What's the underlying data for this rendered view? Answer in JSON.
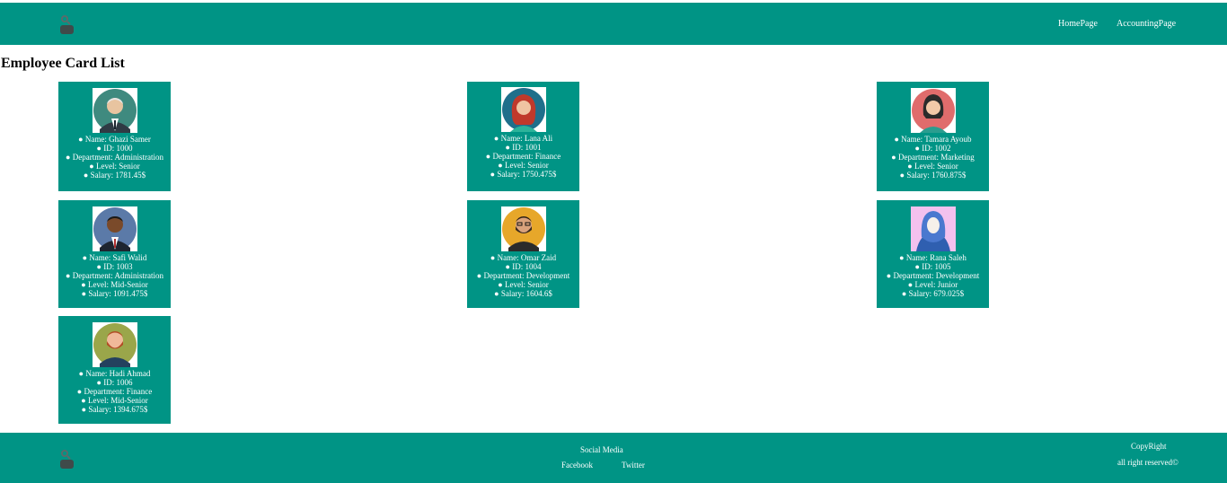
{
  "header": {
    "logo_icon": "user-search-icon",
    "nav": [
      {
        "label": "HomePage"
      },
      {
        "label": "AccountingPage"
      }
    ]
  },
  "main": {
    "title": "Employee Card List",
    "employees": [
      {
        "name": "● Name: Ghazi Samer",
        "id": "● ID: 1000",
        "department": "● Department: Administration",
        "level": "● Level: Senior",
        "salary": "● Salary: 1781.45$",
        "avatar_icon": "old-man-suit-avatar-icon"
      },
      {
        "name": "● Name: Lana Ali",
        "id": "● ID: 1001",
        "department": "● Department: Finance",
        "level": "● Level: Senior",
        "salary": "● Salary: 1750.475$",
        "avatar_icon": "red-hair-woman-avatar-icon"
      },
      {
        "name": "● Name: Tamara Ayoub",
        "id": "● ID: 1002",
        "department": "● Department: Marketing",
        "level": "● Level: Senior",
        "salary": "● Salary: 1760.875$",
        "avatar_icon": "dark-hair-woman-avatar-icon"
      },
      {
        "name": "● Name: Safi Walid",
        "id": "● ID: 1003",
        "department": "● Department: Administration",
        "level": "● Level: Mid-Senior",
        "salary": "● Salary: 1091.475$",
        "avatar_icon": "man-suit-avatar-icon"
      },
      {
        "name": "● Name: Omar Zaid",
        "id": "● ID: 1004",
        "department": "● Department: Development",
        "level": "● Level: Senior",
        "salary": "● Salary: 1604.6$",
        "avatar_icon": "bearded-man-glasses-avatar-icon"
      },
      {
        "name": "● Name: Rana Saleh",
        "id": "● ID: 1005",
        "department": "● Department: Development",
        "level": "● Level: Junior",
        "salary": "● Salary: 679.025$",
        "avatar_icon": "hijab-woman-avatar-icon"
      },
      {
        "name": "● Name: Hadi Ahmad",
        "id": "● ID: 1006",
        "department": "● Department: Finance",
        "level": "● Level: Mid-Senior",
        "salary": "● Salary: 1394.675$",
        "avatar_icon": "ginger-beard-man-avatar-icon"
      }
    ]
  },
  "footer": {
    "logo_icon": "user-search-icon",
    "social_title": "Social Media",
    "social_links": [
      {
        "label": "Facebook"
      },
      {
        "label": "Twitter"
      }
    ],
    "copyright_title": "CopyRight",
    "copyright_text": "all right reserved©"
  },
  "colors": {
    "primary": "#009485",
    "text_on_primary": "#ffffff"
  }
}
